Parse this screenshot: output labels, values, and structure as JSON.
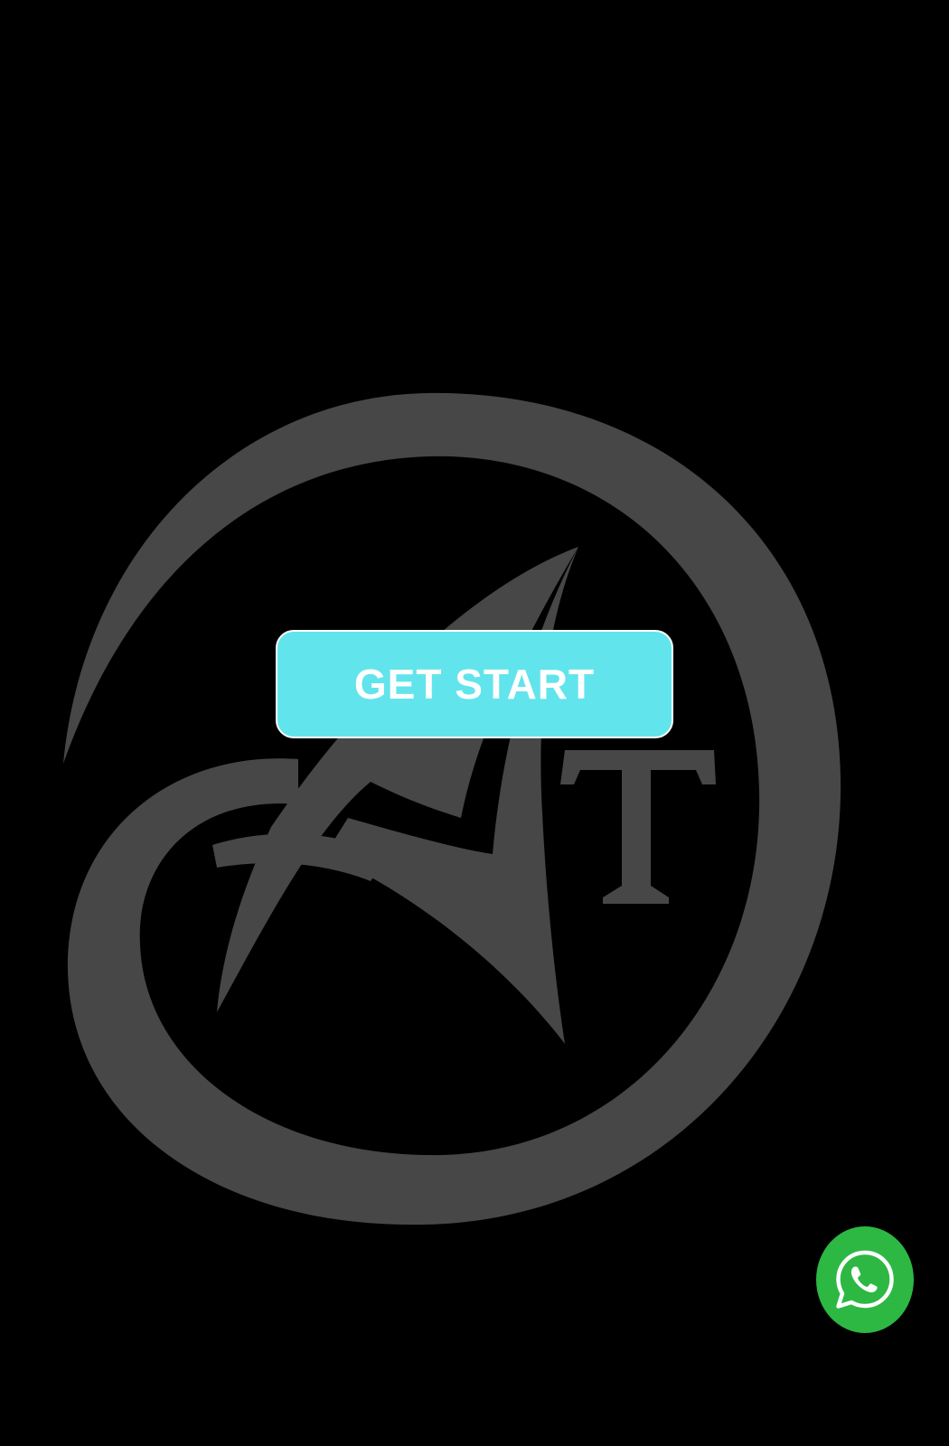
{
  "screen": {
    "background_color": "#000000"
  },
  "logo": {
    "icon": "at-monogram-logo",
    "letters": "AT",
    "color": "#474747"
  },
  "cta": {
    "label": "GET START",
    "background_color": "#62e4ec",
    "text_color": "#ffffff"
  },
  "whatsapp": {
    "icon": "whatsapp-icon",
    "background_color": "#2db843"
  }
}
